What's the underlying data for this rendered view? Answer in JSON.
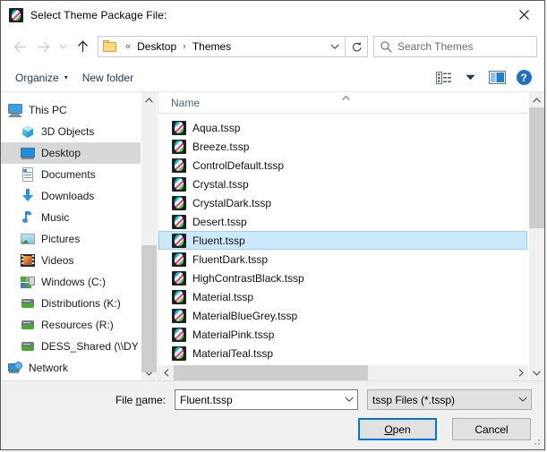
{
  "window": {
    "title": "Select Theme Package File:",
    "icon": "theme-package-icon",
    "close_label": "✕"
  },
  "navbar": {
    "back_icon": "arrow-left-icon",
    "forward_icon": "arrow-right-icon",
    "recent_icon": "chevron-down-icon",
    "up_icon": "arrow-up-icon",
    "folder_icon": "folder-icon",
    "overflow": "«",
    "breadcrumbs": [
      "Desktop",
      "Themes"
    ],
    "separator": "›",
    "dropdown_icon": "chevron-down-icon",
    "refresh_icon": "refresh-icon",
    "refresh_glyph": "↻",
    "search": {
      "placeholder": "Search Themes",
      "icon": "search-icon"
    }
  },
  "commandbar": {
    "organize_label": "Organize",
    "organize_caret": "▾",
    "new_folder_label": "New folder",
    "view_icon": "view-options-icon",
    "view_caret": "▾",
    "preview_pane_icon": "preview-pane-icon",
    "help_icon": "help-icon",
    "help_glyph": "?"
  },
  "navpane": {
    "scroll_up": "ⱏ",
    "scroll_down": "ⱟ",
    "items": [
      {
        "label": "This PC",
        "icon": "this-pc-icon",
        "level": "root",
        "selected": false
      },
      {
        "label": "3D Objects",
        "icon": "3d-objects-icon",
        "level": "child",
        "selected": false
      },
      {
        "label": "Desktop",
        "icon": "desktop-icon",
        "level": "child",
        "selected": true
      },
      {
        "label": "Documents",
        "icon": "documents-icon",
        "level": "child",
        "selected": false
      },
      {
        "label": "Downloads",
        "icon": "downloads-icon",
        "level": "child",
        "selected": false
      },
      {
        "label": "Music",
        "icon": "music-icon",
        "level": "child",
        "selected": false
      },
      {
        "label": "Pictures",
        "icon": "pictures-icon",
        "level": "child",
        "selected": false
      },
      {
        "label": "Videos",
        "icon": "videos-icon",
        "level": "child",
        "selected": false
      },
      {
        "label": "Windows (C:)",
        "icon": "windows-drive-icon",
        "level": "child",
        "selected": false
      },
      {
        "label": "Distributions (K:)",
        "icon": "network-drive-icon",
        "level": "child",
        "selected": false
      },
      {
        "label": "Resources (R:)",
        "icon": "network-drive-icon",
        "level": "child",
        "selected": false
      },
      {
        "label": "DESS_Shared (\\\\DY",
        "icon": "network-drive-icon",
        "level": "child",
        "selected": false
      },
      {
        "label": "Network",
        "icon": "network-icon",
        "level": "root",
        "selected": false
      }
    ]
  },
  "filelist": {
    "column_header": "Name",
    "sort_indicator": "ⱏ",
    "scroll_up": "ⱏ",
    "scroll_down": "ⱟ",
    "scroll_left": "‹",
    "scroll_right": "›",
    "items": [
      {
        "name": "Aqua.tssp",
        "icon": "theme-package-icon",
        "selected": false
      },
      {
        "name": "Breeze.tssp",
        "icon": "theme-package-icon",
        "selected": false
      },
      {
        "name": "ControlDefault.tssp",
        "icon": "theme-package-icon",
        "selected": false
      },
      {
        "name": "Crystal.tssp",
        "icon": "theme-package-icon",
        "selected": false
      },
      {
        "name": "CrystalDark.tssp",
        "icon": "theme-package-icon",
        "selected": false
      },
      {
        "name": "Desert.tssp",
        "icon": "theme-package-icon",
        "selected": false
      },
      {
        "name": "Fluent.tssp",
        "icon": "theme-package-icon",
        "selected": true
      },
      {
        "name": "FluentDark.tssp",
        "icon": "theme-package-icon",
        "selected": false
      },
      {
        "name": "HighContrastBlack.tssp",
        "icon": "theme-package-icon",
        "selected": false
      },
      {
        "name": "Material.tssp",
        "icon": "theme-package-icon",
        "selected": false
      },
      {
        "name": "MaterialBlueGrey.tssp",
        "icon": "theme-package-icon",
        "selected": false
      },
      {
        "name": "MaterialPink.tssp",
        "icon": "theme-package-icon",
        "selected": false
      },
      {
        "name": "MaterialTeal.tssp",
        "icon": "theme-package-icon",
        "selected": false
      }
    ]
  },
  "footer": {
    "filename_label_pre": "File ",
    "filename_label_accel": "n",
    "filename_label_post": "ame:",
    "filename_value": "Fluent.tssp",
    "filetype_value": "tssp Files (*.tssp)",
    "open_pre": "",
    "open_accel": "O",
    "open_post": "pen",
    "cancel_label": "Cancel",
    "chevron": "ⱟ"
  },
  "colors": {
    "accent": "#0078d7",
    "selection_bg": "#cce8ff",
    "selection_border": "#99d1ff",
    "navpane_selected_bg": "#d8d8d8",
    "dialog_bg": "#f0f0f0",
    "column_header_text": "#4a6786"
  }
}
